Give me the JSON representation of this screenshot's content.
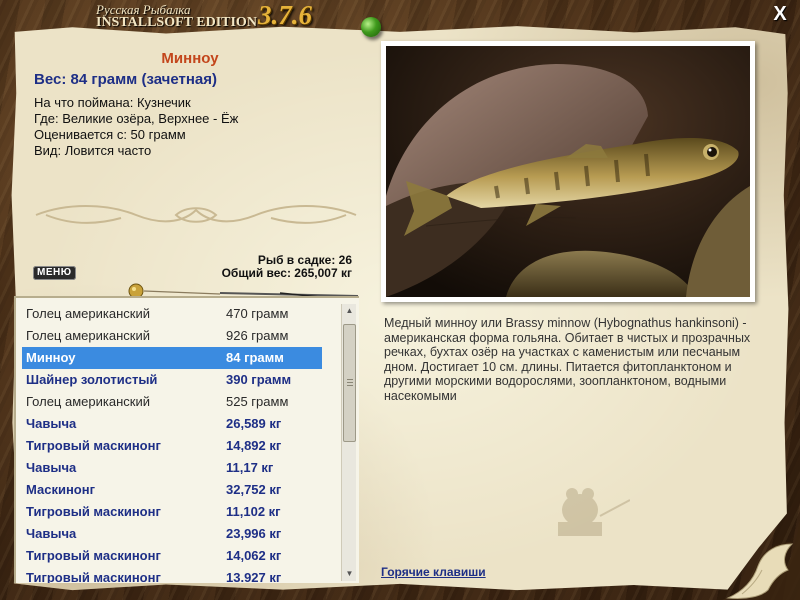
{
  "app": {
    "title_small": "Русская Рыбалка",
    "title_edition": "INSTALLSOFT EDITION",
    "version": "3.7.6",
    "close_label": "X"
  },
  "fish": {
    "name": "Минноу",
    "weight_line": "Вес: 84 грамм (зачетная)",
    "details": [
      "На что поймана: Кузнечик",
      "Где: Великие озёра, Верхнее - Ёж",
      "Оценивается с: 50 грамм",
      "Вид: Ловится часто"
    ],
    "description": "Медный минноу или Brassy minnow (Hybognathus hankinsoni) - американская форма гольяна. Обитает в чистых и прозрачных речках, бухтах озёр на участках с каменистым или песчаным дном. Достигает 10 см. длины. Питается фитопланктоном и другими морскими водорослями, зоопланктоном, водными насекомыми"
  },
  "cage": {
    "count_line": "Рыб в садке: 26",
    "total_line": "Общий вес: 265,007 кг"
  },
  "menu_label": "МЕНЮ",
  "catch_list": [
    {
      "name": "Голец американский",
      "weight": "470 грамм",
      "style": "plain"
    },
    {
      "name": "Голец американский",
      "weight": "926 грамм",
      "style": "plain"
    },
    {
      "name": "Минноу",
      "weight": "84 грамм",
      "style": "selected"
    },
    {
      "name": "Шайнер золотистый",
      "weight": "390 грамм",
      "style": "bold"
    },
    {
      "name": "Голец американский",
      "weight": "525 грамм",
      "style": "plain"
    },
    {
      "name": "Чавыча",
      "weight": "26,589 кг",
      "style": "bold"
    },
    {
      "name": "Тигровый маскинонг",
      "weight": "14,892 кг",
      "style": "bold"
    },
    {
      "name": "Чавыча",
      "weight": "11,17 кг",
      "style": "bold"
    },
    {
      "name": "Маскинонг",
      "weight": "32,752 кг",
      "style": "bold"
    },
    {
      "name": "Тигровый маскинонг",
      "weight": "11,102 кг",
      "style": "bold"
    },
    {
      "name": "Чавыча",
      "weight": "23,996 кг",
      "style": "bold"
    },
    {
      "name": "Тигровый маскинонг",
      "weight": "14,062 кг",
      "style": "bold"
    },
    {
      "name": "Тигровый маскинонг",
      "weight": "13.927 кг",
      "style": "bold"
    }
  ],
  "hotkeys_label": "Горячие клавиши",
  "colors": {
    "accent_name": "#c3461c",
    "accent_blue": "#1e2f86",
    "selection": "#3b8be0",
    "parchment": "#ece3c7"
  }
}
